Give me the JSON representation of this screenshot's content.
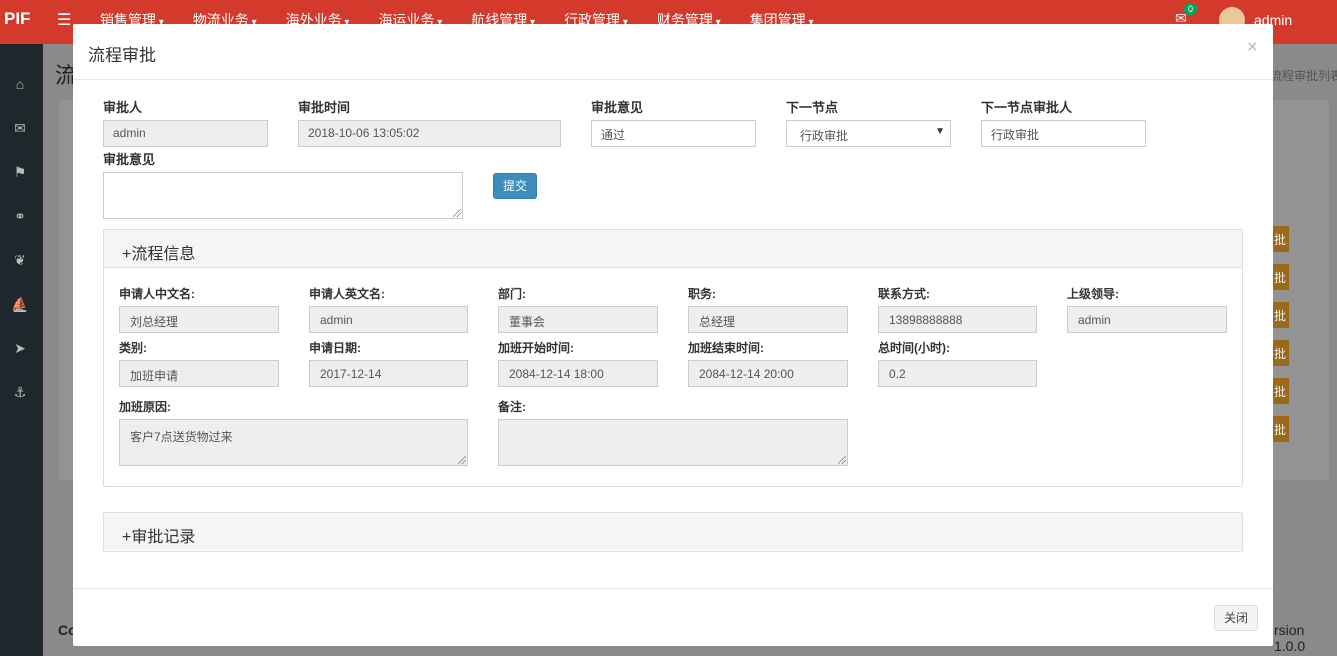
{
  "topbar": {
    "brand": "PIF",
    "menu": [
      "销售管理",
      "物流业务",
      "海外业务",
      "海运业务",
      "航线管理",
      "行政管理",
      "财务管理",
      "集团管理"
    ],
    "notification_count": "0",
    "user": "admin"
  },
  "background": {
    "page_title": "流",
    "breadcrumb": "流程审批列表",
    "row_buttons": [
      "批",
      "批",
      "批",
      "批",
      "批",
      "批"
    ],
    "footer_left": "Co",
    "footer_right": "rsion 1.0.0"
  },
  "modal": {
    "title": "流程审批",
    "close_glyph": "×",
    "approval": {
      "approver_label": "审批人",
      "approver_value": "admin",
      "time_label": "审批时间",
      "time_value": "2018-10-06 13:05:02",
      "opinion_label": "审批意见",
      "opinion_value": "通过",
      "next_node_label": "下一节点",
      "next_node_value": "行政审批",
      "next_approver_label": "下一节点审批人",
      "next_approver_value": "行政审批",
      "comment_label": "审批意见",
      "comment_value": "",
      "submit_label": "提交"
    },
    "process_info": {
      "heading": "+流程信息",
      "fields": {
        "applicant_cn_label": "申请人中文名:",
        "applicant_cn": "刘总经理",
        "applicant_en_label": "申请人英文名:",
        "applicant_en": "admin",
        "dept_label": "部门:",
        "dept": "董事会",
        "position_label": "职务:",
        "position": "总经理",
        "contact_label": "联系方式:",
        "contact": "13898888888",
        "leader_label": "上级领导:",
        "leader": "admin",
        "category_label": "类别:",
        "category": "加班申请",
        "apply_date_label": "申请日期:",
        "apply_date": "2017-12-14",
        "ot_start_label": "加班开始时间:",
        "ot_start": "2084-12-14 18:00",
        "ot_end_label": "加班结束时间:",
        "ot_end": "2084-12-14 20:00",
        "total_label": "总时间(小时):",
        "total": "0.2",
        "reason_label": "加班原因:",
        "reason": "客户7点送货物过来",
        "remark_label": "备注:",
        "remark": ""
      }
    },
    "approval_records": {
      "heading": "+审批记录"
    },
    "footer": {
      "close_label": "关闭"
    }
  }
}
